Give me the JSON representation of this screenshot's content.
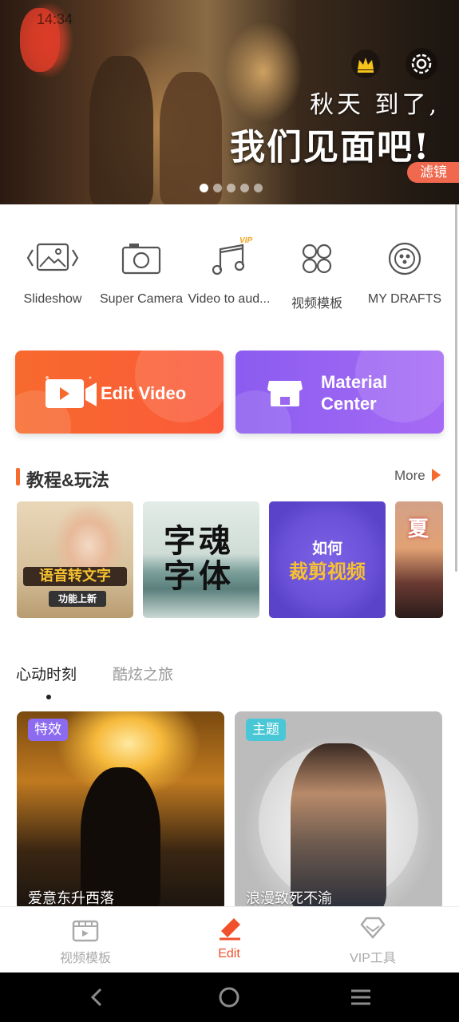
{
  "status_bar": {
    "time": "14:34"
  },
  "banner": {
    "line1": "秋天 到了,",
    "line2": "我们见面吧!",
    "tag": "滤镜",
    "dots_total": 5,
    "dots_active": 1,
    "icons": [
      "crown-icon",
      "gear-icon"
    ]
  },
  "tools": [
    {
      "label": "Slideshow",
      "icon": "slideshow-icon"
    },
    {
      "label": "Super Camera",
      "icon": "camera-icon"
    },
    {
      "label": "Video to aud...",
      "icon": "music-note-icon",
      "badge": "VIP"
    },
    {
      "label": "视频模板",
      "icon": "template-icon"
    },
    {
      "label": "MY DRAFTS",
      "icon": "drafts-icon"
    }
  ],
  "cards": {
    "edit_video": "Edit Video",
    "material_line1": "Material",
    "material_line2": "Center"
  },
  "tutorials": {
    "title": "教程&玩法",
    "more": "More",
    "items": [
      {
        "line1": "语音转文字",
        "line2": "功能上新"
      },
      {
        "line1": "字魂",
        "line2": "字体"
      },
      {
        "line1": "如何",
        "line2": "裁剪视频"
      },
      {
        "line1": "夏"
      }
    ]
  },
  "tabs": {
    "active": "心动时刻",
    "inactive": "酷炫之旅"
  },
  "features": [
    {
      "tag": "特效",
      "caption": "爱意东升西落",
      "tag_color": "#8d6bf0"
    },
    {
      "tag": "主题",
      "caption": "浪漫致死不渝",
      "tag_color": "#49c7d6"
    }
  ],
  "bottom_nav": [
    {
      "label": "视频模板",
      "icon": "video-template-icon"
    },
    {
      "label": "Edit",
      "icon": "edit-icon",
      "active": true
    },
    {
      "label": "VIP工具",
      "icon": "vip-diamond-icon"
    }
  ]
}
